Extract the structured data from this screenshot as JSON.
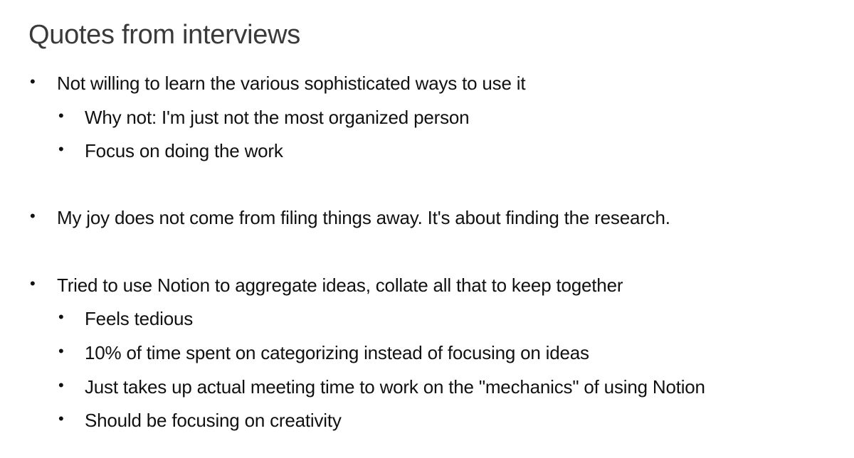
{
  "title": "Quotes from interviews",
  "bullet_glyph": "•",
  "items": [
    {
      "level": 1,
      "text": "Not willing to learn the various sophisticated ways to use it"
    },
    {
      "level": 2,
      "text": "Why not: I'm just not the most organized person"
    },
    {
      "level": 2,
      "text": "Focus on doing the work"
    },
    {
      "level": 1,
      "text": "My joy does not come from filing things away. It's about finding the research."
    },
    {
      "level": 1,
      "text": "Tried to use Notion to aggregate ideas, collate all that to keep together"
    },
    {
      "level": 2,
      "text": "Feels tedious"
    },
    {
      "level": 2,
      "text": "10% of time spent on categorizing instead of focusing on ideas"
    },
    {
      "level": 2,
      "text": "Just takes up actual meeting time to work on the \"mechanics\" of using Notion"
    },
    {
      "level": 2,
      "text": "Should be focusing on creativity"
    }
  ]
}
